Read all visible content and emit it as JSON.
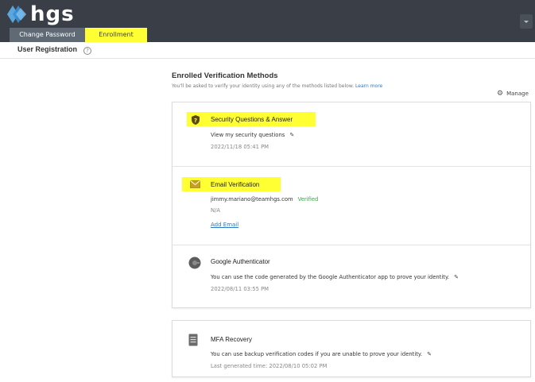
{
  "header": {
    "logo_text": "hgs",
    "tabs": [
      {
        "label": "Change Password"
      },
      {
        "label": "Enrollment"
      }
    ]
  },
  "subheader": {
    "title": "User Registration",
    "help_glyph": "?"
  },
  "section": {
    "title": "Enrolled Verification Methods",
    "description": "You'll be asked to verify your identity using any of the methods listed below.",
    "learn_more": "Learn more",
    "manage_label": "Manage"
  },
  "methods": {
    "security": {
      "title": "Security Questions & Answer",
      "action": "View my security questions",
      "timestamp": "2022/11/18 05:41 PM"
    },
    "email": {
      "title": "Email Verification",
      "address": "jimmy.mariano@teamhgs.com",
      "status": "Verified",
      "secondary": "N/A",
      "add_link": "Add Email"
    },
    "google": {
      "title": "Google Authenticator",
      "description": "You can use the code generated by the Google Authenticator app to prove your identity.",
      "timestamp": "2022/08/11 03:55 PM"
    },
    "mfa": {
      "title": "MFA Recovery",
      "description": "You can use backup verification codes if you are unable to prove your identity.",
      "timestamp": "Last generated time: 2022/08/10 05:02 PM"
    }
  },
  "colors": {
    "header_bg": "#3a3f47",
    "highlight": "#ffff33",
    "link": "#2a77c4",
    "verified": "#3aa54a"
  }
}
